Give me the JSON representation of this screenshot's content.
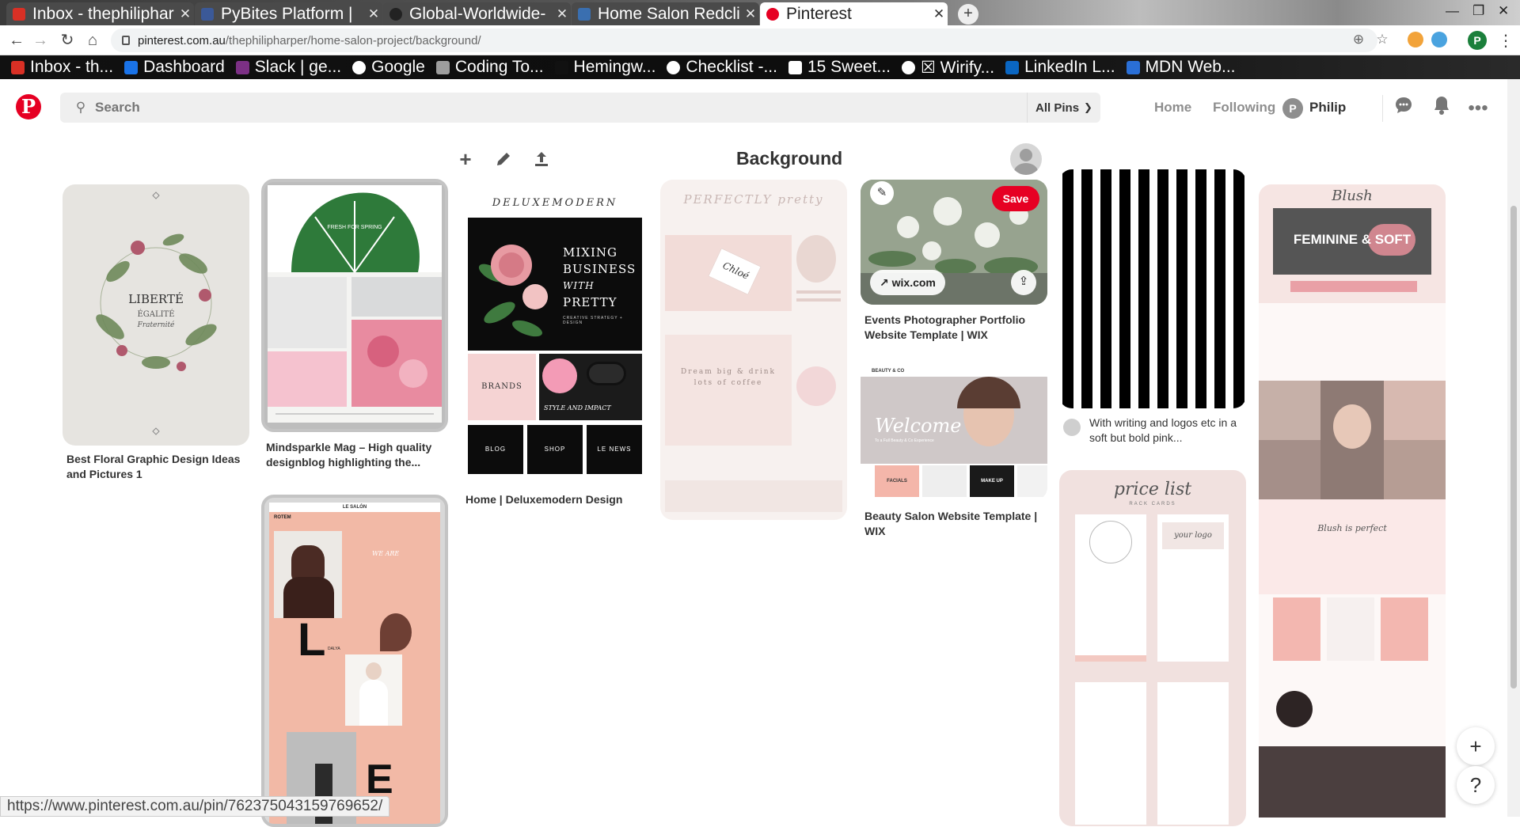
{
  "browser": {
    "tabs": [
      {
        "title": "Inbox - thephiliphar",
        "icon": "gmail-icon",
        "color": "#d93025"
      },
      {
        "title": "PyBites Platform | ",
        "icon": "pybites-icon",
        "color": "#3b5998"
      },
      {
        "title": "Global-Worldwide-",
        "icon": "github-icon",
        "color": "#222222"
      },
      {
        "title": "Home Salon Redcli",
        "icon": "page-icon",
        "color": "#3a6fb0"
      },
      {
        "title": "Pinterest",
        "icon": "pinterest-icon",
        "color": "#e60023",
        "active": true
      }
    ],
    "new_tab": "+",
    "address": {
      "host": "pinterest.com.au",
      "path": "/thephilipharper/home-salon-project/background/"
    },
    "profile_initial": "P",
    "bookmarks": [
      {
        "label": "Inbox - th...",
        "color": "#d93025"
      },
      {
        "label": "Dashboard",
        "color": "#1a73e8"
      },
      {
        "label": "Slack | ge...",
        "color": "#7c3085"
      },
      {
        "label": "Google",
        "color": "#ffffff"
      },
      {
        "label": "Coding To...",
        "color": "#9e9e9e"
      },
      {
        "label": "Hemingw...",
        "color": "#111111"
      },
      {
        "label": "Checklist -...",
        "color": "#ffffff"
      },
      {
        "label": "15 Sweet...",
        "color": "#ffffff"
      },
      {
        "label": "☒ Wirify...",
        "color": "#ffffff"
      },
      {
        "label": "LinkedIn L...",
        "color": "#0a66c2"
      },
      {
        "label": "MDN Web...",
        "color": "#2a6fd6"
      }
    ],
    "status_url": "https://www.pinterest.com.au/pin/762375043159769652/"
  },
  "header": {
    "logo": "P",
    "search_placeholder": "Search",
    "all_pins": "All Pins",
    "nav": {
      "home": "Home",
      "following": "Following"
    },
    "profile_initial": "P",
    "profile_name": "Philip"
  },
  "board": {
    "title": "Background"
  },
  "pins": [
    {
      "id": "floral",
      "caption": "Best Floral Graphic Design Ideas and Pictures 1",
      "image_text": {
        "line1": "LIBERTÉ",
        "line2": "ÉGALITÉ",
        "line3": "Fraternité"
      }
    },
    {
      "id": "mindsparkle",
      "caption": "Mindsparkle Mag – High quality designblog highlighting the...",
      "image_text": {
        "tag": "FRESH FOR SPRING"
      }
    },
    {
      "id": "lesalon",
      "caption": "",
      "image_text": {
        "brand": "LE SALÓN",
        "name1": "ROTEM",
        "name2": "DALYA",
        "we_are": "WE ARE",
        "letter1": "L",
        "letter2": "E"
      }
    },
    {
      "id": "deluxe",
      "caption": "Home | Deluxemodern Design",
      "image_text": {
        "brand": "DELUXEMODERN",
        "headline1": "MIXING",
        "headline2": "BUSINESS",
        "headline3": "WITH",
        "headline4": "PRETTY",
        "sub": "CREATIVE STRATEGY + DESIGN",
        "brands": "BRANDS",
        "impact": "STYLE AND IMPACT",
        "btn1": "BLOG",
        "btn2": "SHOP",
        "btn3": "LE NEWS"
      }
    },
    {
      "id": "perfectly",
      "caption": "",
      "image_text": {
        "title": "PERFECTLY pretty",
        "brand": "Chloé",
        "quote": "Dream big & drink lots of coffee"
      }
    },
    {
      "id": "events",
      "caption": "Events Photographer Portfolio Website Template | WIX",
      "domain": "wix.com",
      "save": "Save"
    },
    {
      "id": "beauty",
      "caption": "Beauty Salon Website Template | WIX",
      "image_text": {
        "brand": "BEAUTY & CO",
        "welcome": "Welcome",
        "sub": "To a Full Beauty & Co Experience",
        "facials": "FACIALS",
        "makeup": "MAKE UP"
      }
    },
    {
      "id": "stripes",
      "caption": "With writing and logos etc in a soft but bold pink..."
    },
    {
      "id": "pricelist",
      "caption": "",
      "image_text": {
        "title": "price list",
        "sub": "RACK CARDS",
        "logo": "your logo"
      }
    },
    {
      "id": "blush",
      "caption": "",
      "image_text": {
        "brand": "Blush",
        "headline": "FEMININE & SOFT",
        "tagline": "Blush is perfect"
      }
    }
  ],
  "floating": {
    "add": "+",
    "help": "?"
  }
}
